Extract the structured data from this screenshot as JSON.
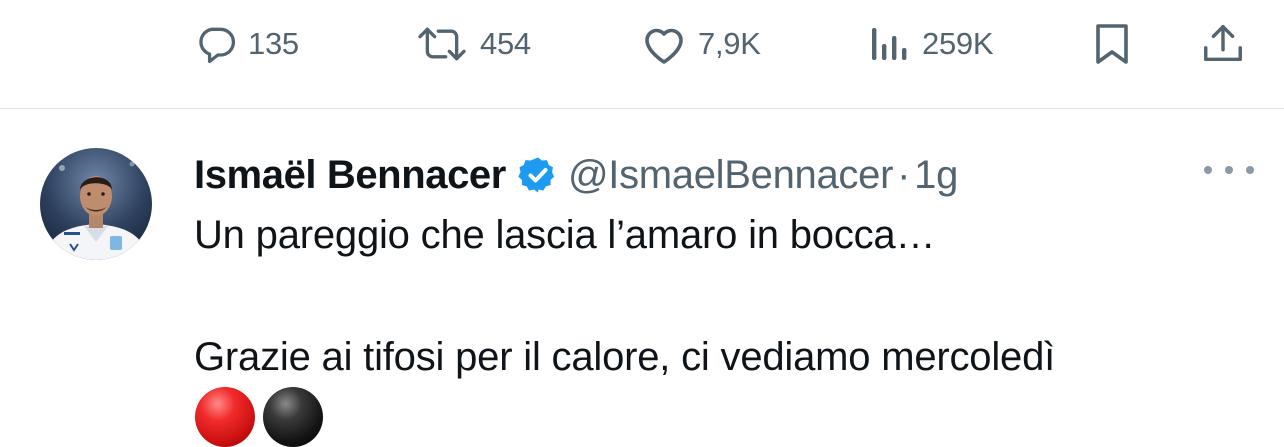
{
  "action_bar": {
    "replies": {
      "icon": "reply-icon",
      "count": "135"
    },
    "reposts": {
      "icon": "repost-icon",
      "count": "454"
    },
    "likes": {
      "icon": "heart-icon",
      "count": "7,9K"
    },
    "views": {
      "icon": "views-chart-icon",
      "count": "259K"
    },
    "bookmark": {
      "icon": "bookmark-icon"
    },
    "share": {
      "icon": "share-icon"
    }
  },
  "reply_tweet": {
    "author": {
      "display_name": "Ismaël Bennacer",
      "verified": true,
      "handle": "@IsmaelBennacer",
      "separator": "·",
      "time": "1g"
    },
    "more_icon": "more-dots-icon",
    "text_line_1": "Un pareggio che lascia l’amaro in bocca…",
    "text_line_2": "Grazie ai tifosi per il calore, ci vediamo mercoledì",
    "emojis": [
      "red-circle",
      "black-circle"
    ]
  },
  "colors": {
    "text_primary": "#0f1419",
    "text_secondary": "#536471",
    "verified_blue": "#1d9bf0",
    "divider": "#dfe3e6"
  }
}
